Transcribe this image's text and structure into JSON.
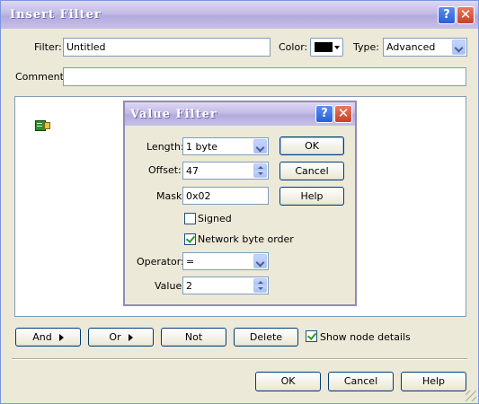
{
  "window": {
    "title": "Insert Filter",
    "help_glyph": "?",
    "close_glyph": "✕"
  },
  "filter": {
    "filter_label": "Filter:",
    "filter_value": "Untitled",
    "color_label": "Color:",
    "color_value": "#000000",
    "type_label": "Type:",
    "type_value": "Advanced",
    "comment_label": "Comment:",
    "comment_value": ""
  },
  "tree": {
    "root_icon": "filter-node-icon"
  },
  "value_filter": {
    "title": "Value Filter",
    "length_label": "Length:",
    "length_value": "1 byte",
    "offset_label": "Offset:",
    "offset_value": "47",
    "mask_label": "Mask:",
    "mask_value": "0x02",
    "signed_label": "Signed",
    "signed_checked": false,
    "network_label": "Network byte order",
    "network_checked": true,
    "operator_label": "Operator:",
    "operator_value": "=",
    "value_label": "Value:",
    "value_value": "2",
    "ok_label": "OK",
    "cancel_label": "Cancel",
    "help_label": "Help"
  },
  "toolbar": {
    "and_label": "And",
    "or_label": "Or",
    "not_label": "Not",
    "delete_label": "Delete",
    "show_details_label": "Show node details",
    "show_details_checked": true
  },
  "footer": {
    "ok_label": "OK",
    "cancel_label": "Cancel",
    "help_label": "Help"
  }
}
